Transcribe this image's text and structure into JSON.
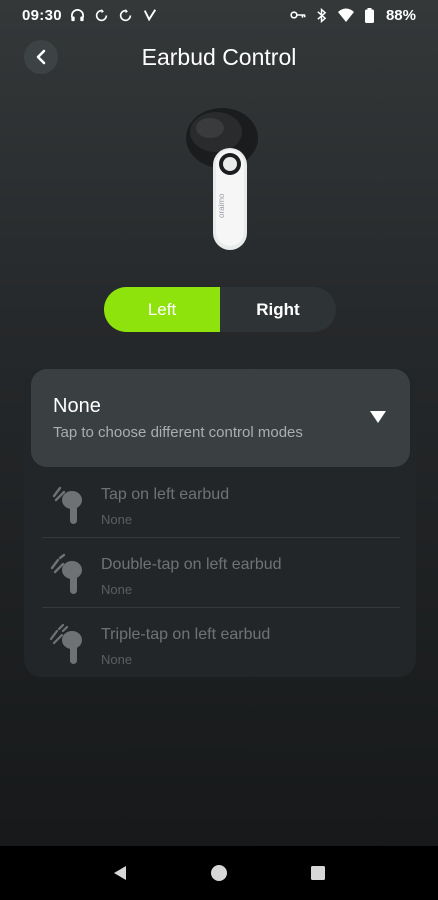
{
  "status_bar": {
    "time": "09:30",
    "battery": "88%",
    "icons": [
      "headset-icon",
      "sync-icon",
      "sync-icon",
      "check-icon",
      "key-icon",
      "bluetooth-icon",
      "wifi-icon",
      "battery-icon"
    ]
  },
  "header": {
    "title": "Earbud Control",
    "back_icon": "chevron-left-icon"
  },
  "earbud": {
    "brand": "oraimo"
  },
  "side_selector": {
    "left_label": "Left",
    "right_label": "Right",
    "selected": "Left"
  },
  "mode": {
    "title": "None",
    "description": "Tap to choose different control modes"
  },
  "gestures": [
    {
      "label": "Tap on left earbud",
      "value": "None"
    },
    {
      "label": "Double-tap on left earbud",
      "value": "None"
    },
    {
      "label": "Triple-tap on left earbud",
      "value": "None"
    }
  ],
  "colors": {
    "accent": "#8fe30d",
    "card": "#3a3f42",
    "background": "#26292b"
  }
}
